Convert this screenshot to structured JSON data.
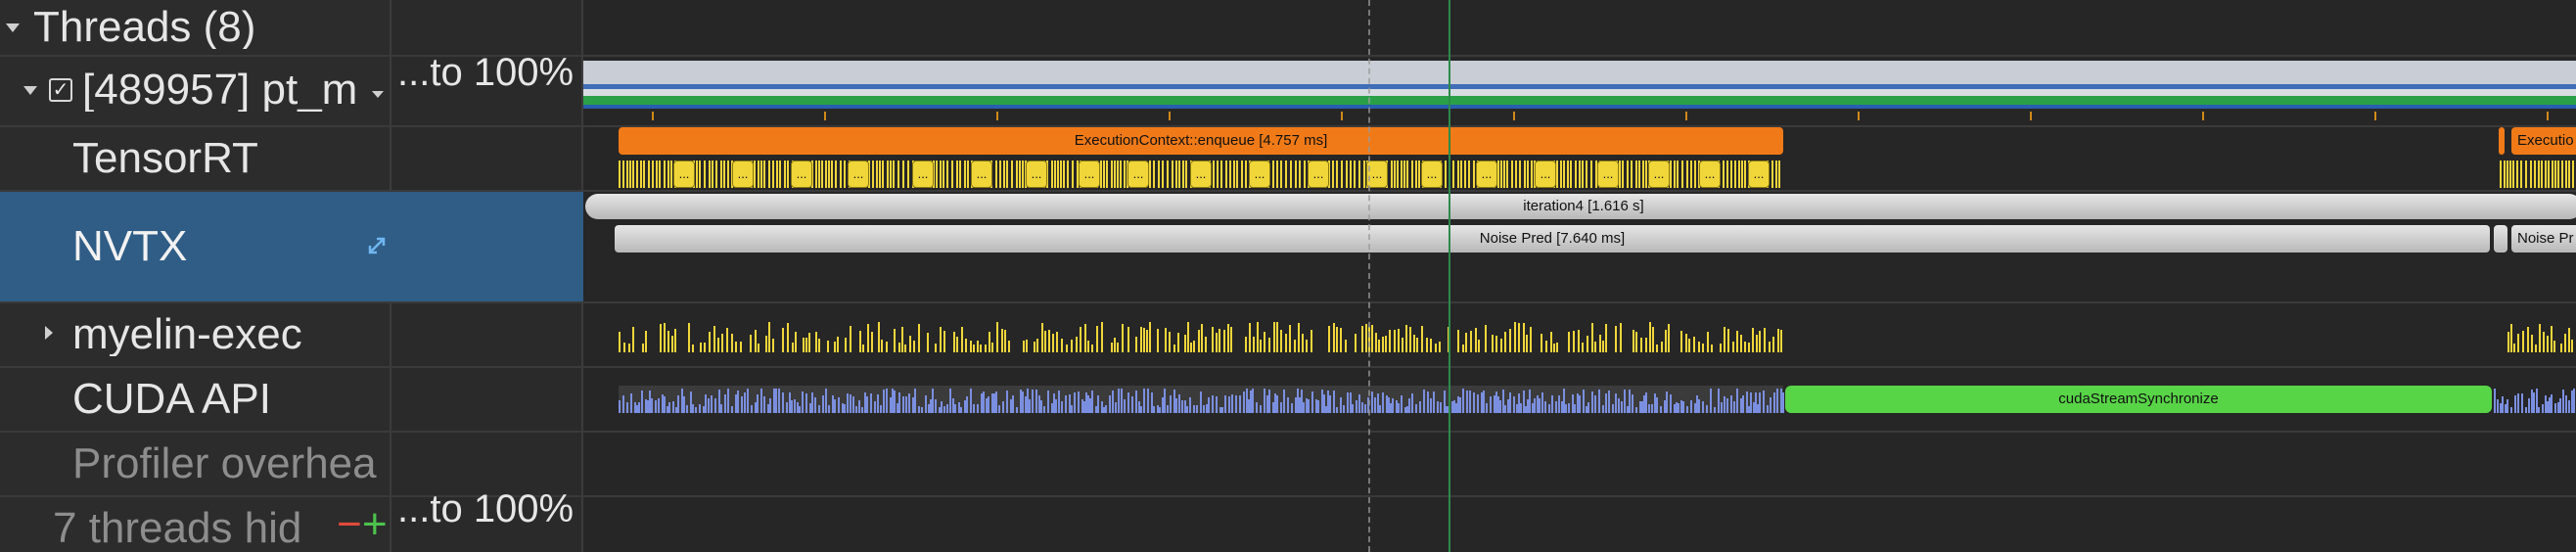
{
  "tree": {
    "threads_header": "Threads (8)",
    "thread_row": "[489957] pt_m",
    "thread_checked": true,
    "tensorrt": "TensorRT",
    "nvtx": "NVTX",
    "myelin": "myelin-exec",
    "cuda_api": "CUDA API",
    "profiler_overhead": "Profiler overhea",
    "threads_hidden": "7 threads hid",
    "minus_label": "−",
    "plus_label": "+"
  },
  "scale": {
    "top": "...to 100%",
    "bottom": "...to 100%"
  },
  "timeline": {
    "enqueue_label": "ExecutionContext::enqueue [4.757 ms]",
    "enqueue_label_2": "Executio",
    "iteration_label": "iteration4 [1.616 s]",
    "noise_pred_label": "Noise Pred [7.640 ms]",
    "noise_pred_label_2": "Noise Pr",
    "sync_label": "cudaStreamSynchronize",
    "small_marker": "(...",
    "colors": {
      "enqueue": "#f07a18",
      "kernel": "#f1d63a",
      "nvtx": "#c9c9c9",
      "sync": "#58d447",
      "cuda_api": "#7b8fe0",
      "selected_row": "#2f5d86"
    }
  }
}
